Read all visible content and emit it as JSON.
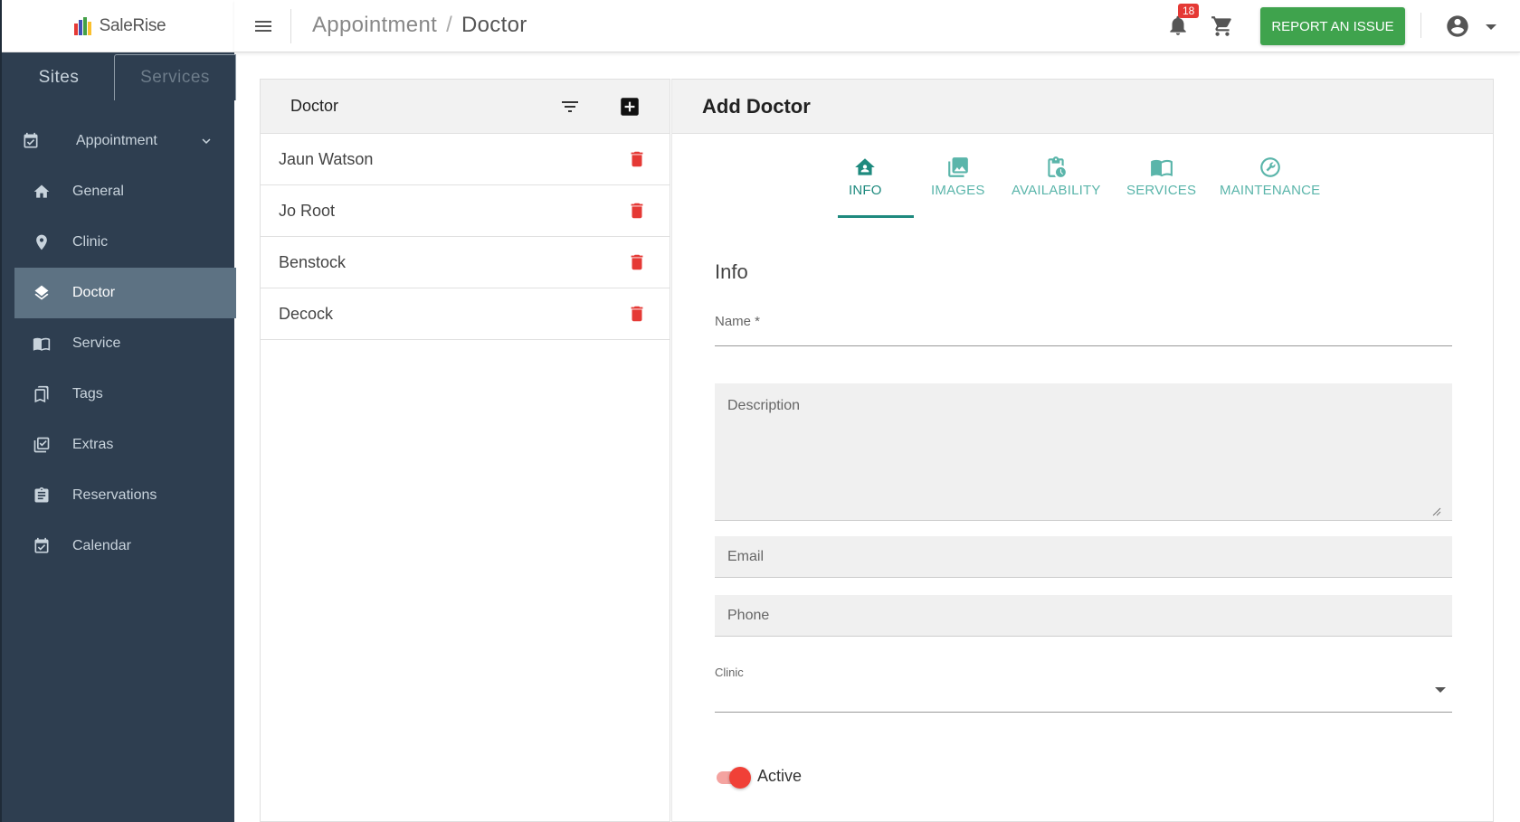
{
  "app": {
    "logo_text": "SaleRise"
  },
  "sidebar": {
    "tabs": [
      {
        "label": "Sites"
      },
      {
        "label": "Services"
      }
    ],
    "parent": {
      "label": "Appointment",
      "icon": "calendar-check-icon"
    },
    "items": [
      {
        "label": "General",
        "icon": "home-icon"
      },
      {
        "label": "Clinic",
        "icon": "location-pin-icon"
      },
      {
        "label": "Doctor",
        "icon": "layers-icon",
        "active": true
      },
      {
        "label": "Service",
        "icon": "book-icon"
      },
      {
        "label": "Tags",
        "icon": "bookmark-icon"
      },
      {
        "label": "Extras",
        "icon": "checklist-icon"
      },
      {
        "label": "Reservations",
        "icon": "clipboard-icon"
      },
      {
        "label": "Calendar",
        "icon": "calendar-icon"
      }
    ]
  },
  "topbar": {
    "breadcrumb": {
      "parent": "Appointment",
      "separator": "/",
      "current": "Doctor"
    },
    "notifications_count": "18",
    "report_button": "REPORT AN ISSUE"
  },
  "list": {
    "title": "Doctor",
    "items": [
      {
        "name": "Jaun Watson"
      },
      {
        "name": "Jo Root"
      },
      {
        "name": "Benstock"
      },
      {
        "name": "Decock"
      }
    ]
  },
  "form": {
    "title": "Add Doctor",
    "tabs": [
      {
        "label": "INFO",
        "icon": "home-user-icon",
        "active": true
      },
      {
        "label": "IMAGES",
        "icon": "images-icon"
      },
      {
        "label": "AVAILABILITY",
        "icon": "availability-icon"
      },
      {
        "label": "SERVICES",
        "icon": "book-open-icon"
      },
      {
        "label": "MAINTENANCE",
        "icon": "wrench-icon"
      }
    ],
    "section_title": "Info",
    "fields": {
      "name": "Name *",
      "description": "Description",
      "email": "Email",
      "phone": "Phone",
      "clinic": "Clinic"
    },
    "active_toggle": {
      "label": "Active",
      "on": true
    }
  },
  "colors": {
    "sidebar_bg": "#2e3e50",
    "sidebar_active": "#5d7283",
    "accent_teal": "#1e8a7e",
    "report_green": "#3fa34d",
    "danger_red": "#e53935"
  }
}
